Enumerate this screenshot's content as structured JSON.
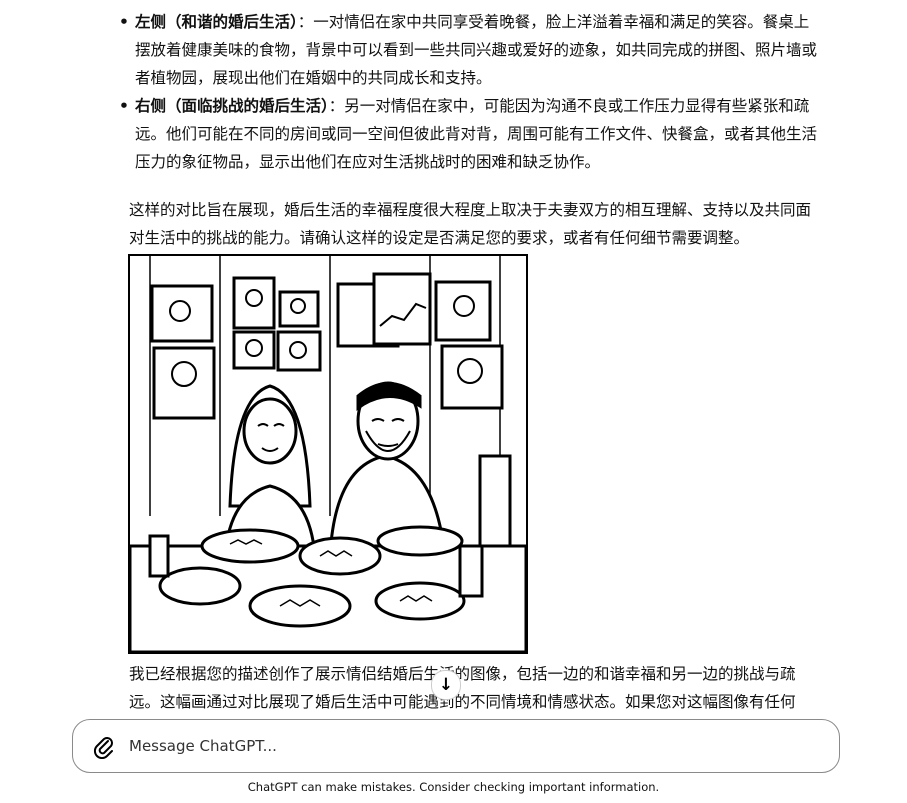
{
  "conversation": {
    "bullets": [
      {
        "title": "左侧（和谐的婚后生活）",
        "text": "：一对情侣在家中共同享受着晚餐，脸上洋溢着幸福和满足的笑容。餐桌上摆放着健康美味的食物，背景中可以看到一些共同兴趣或爱好的迹象，如共同完成的拼图、照片墙或者植物园，展现出他们在婚姻中的共同成长和支持。"
      },
      {
        "title": "右侧（面临挑战的婚后生活）",
        "text": "：另一对情侣在家中，可能因为沟通不良或工作压力显得有些紧张和疏远。他们可能在不同的房间或同一空间但彼此背对背，周围可能有工作文件、快餐盒，或者其他生活压力的象征物品，显示出他们在应对生活挑战时的困难和缺乏协作。"
      }
    ],
    "paragraph_1": "这样的对比旨在展现，婚后生活的幸福程度很大程度上取决于夫妻双方的相互理解、支持以及共同面对生活中的挑战的能力。请确认这样的设定是否满足您的要求，或者有任何细节需要调整。",
    "paragraph_2": "我已经根据您的描述创作了展示情侣结婚后生活的图像，包括一边的和谐幸福和另一边的挑战与疏远。这幅画通过对比展现了婚后生活中可能遇到的不同情境和情感状态。如果您对这幅图像有任何"
  },
  "composer": {
    "placeholder": "Message ChatGPT..."
  },
  "footer": {
    "disclaimer": "ChatGPT can make mistakes. Consider checking important information."
  },
  "icons": {
    "attach": "paperclip-icon",
    "scroll": "arrow-down-icon"
  }
}
